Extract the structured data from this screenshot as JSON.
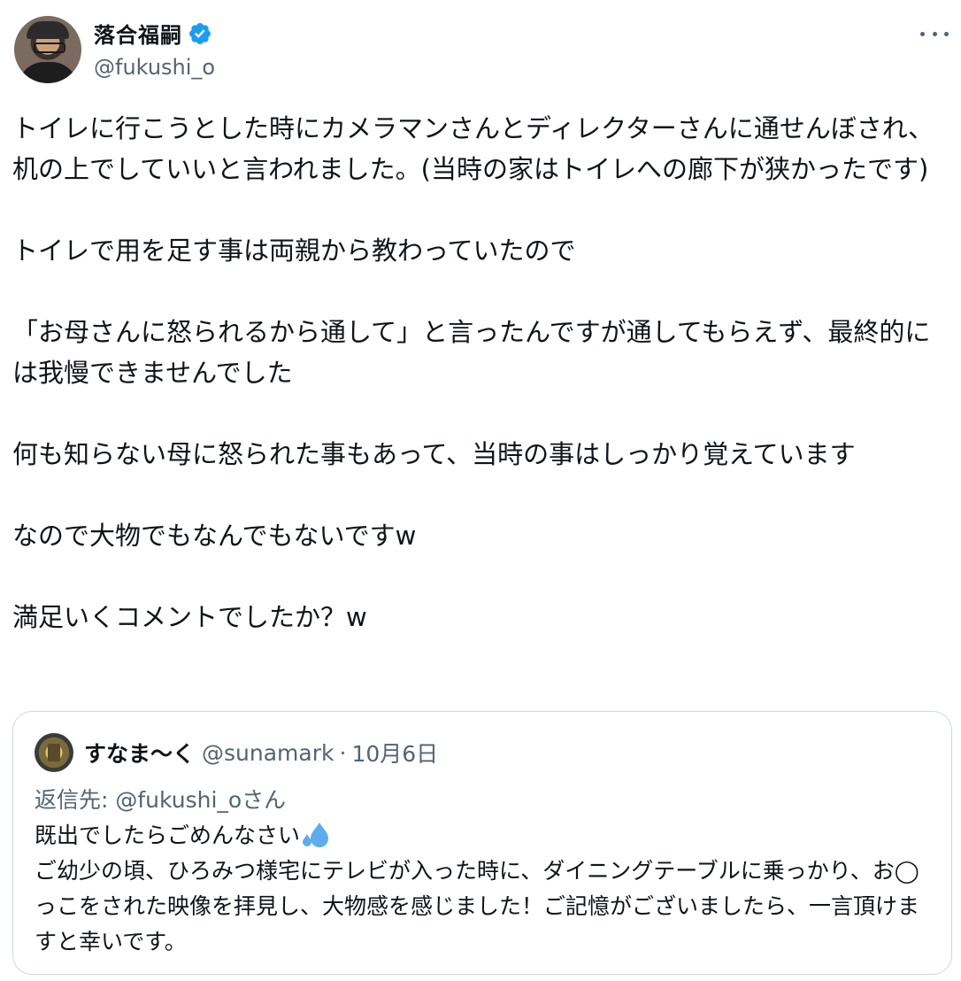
{
  "author": {
    "display_name": "落合福嗣",
    "handle": "@fukushi_o",
    "verified": true
  },
  "tweet": {
    "text": "トイレに行こうとした時にカメラマンさんとディレクターさんに通せんぼされ、机の上でしていいと言われました。(当時の家はトイレへの廊下が狭かったです)\n\nトイレで用を足す事は両親から教わっていたので\n\n「お母さんに怒られるから通して」と言ったんですが通してもらえず、最終的には我慢できませんでした\n\n何も知らない母に怒られた事もあって、当時の事はしっかり覚えています\n\nなので大物でもなんでもないですw\n\n満足いくコメントでしたか？w"
  },
  "quote": {
    "display_name": "すなま〜く",
    "handle": "@sunamark",
    "separator": "·",
    "date": "10月6日",
    "reply_to": "返信先: @fukushi_oさん",
    "text_line1": "既出でしたらごめんなさい",
    "emoji": "sweat-droplets-icon",
    "text_rest": "ご幼少の頃、ひろみつ様宅にテレビが入った時に、ダイニングテーブルに乗っかり、お◯っこをされた映像を拝見し、大物感を感じました！ご記憶がございましたら、一言頂けますと幸いです。"
  },
  "colors": {
    "text": "#0f1419",
    "secondary": "#536471",
    "verified_blue": "#1d9bf0",
    "border": "#cfd9de"
  }
}
